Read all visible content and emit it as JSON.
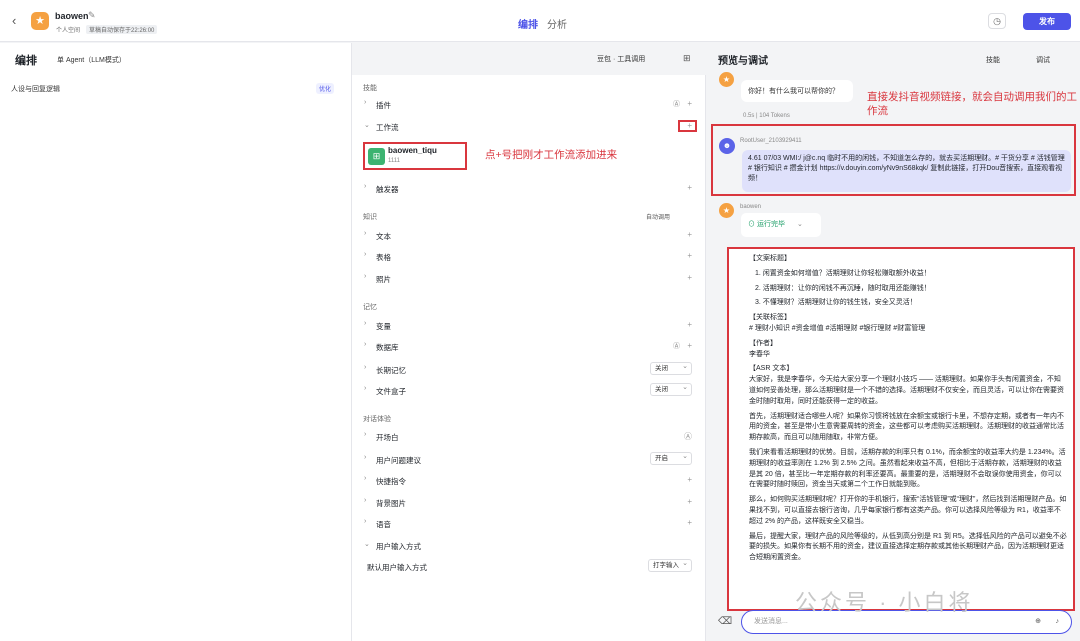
{
  "header": {
    "back": "‹",
    "app_name": "baowen",
    "space": "个人空间",
    "autosave": "草稿自动保存于22:26:00",
    "tab_arrange": "编排",
    "tab_analysis": "分析",
    "publish": "发布"
  },
  "left": {
    "title": "编排",
    "agent_mode": "单 Agent（LLM模式）",
    "persona": "人设与回复逻辑",
    "optimize": "优化"
  },
  "mid": {
    "model": "豆包 · 工具调用",
    "skills_title": "技能",
    "plugin": "插件",
    "workflow": "工作流",
    "wf_name": "baowen_tiqu",
    "wf_sub": "1111",
    "trigger": "触发器",
    "knowledge_title": "知识",
    "auto_call": "自动调用",
    "text": "文本",
    "table": "表格",
    "photo": "照片",
    "memory_title": "记忆",
    "variable": "变量",
    "database": "数据库",
    "long_memory": "长期记忆",
    "long_memory_val": "关闭",
    "filebox": "文件盒子",
    "filebox_val": "关闭",
    "dialog_title": "对话体验",
    "opening": "开场白",
    "suggest": "用户问题建议",
    "suggest_val": "开启",
    "shortcut": "快捷指令",
    "bg_image": "背景图片",
    "voice": "语音",
    "user_input": "用户输入方式",
    "default_input": "默认用户输入方式",
    "default_input_val": "打字输入"
  },
  "annotations": {
    "add": "点+号把刚才工作流添加进来",
    "auto": "直接发抖音视频链接，就会自动调用我们的工作流"
  },
  "preview": {
    "title": "预览与调试",
    "skills": "技能",
    "debug": "调试",
    "greeting": "你好！有什么我可以帮你的？",
    "tokens": "0.5s | 104 Tokens",
    "user_name": "RootUser_2103929411",
    "user_msg": "4.61 07/03 WMI:/ j@c.nq 临时不用的闲钱，不知道怎么存的，就去买活期理财。# 干货分享 # 活钱管理 # 银行知识 # 攒金计划 https://v.douyin.com/yNv9nS68kqk/ 复制此链接，打开Dou音搜索，直接观看视频！",
    "bot_name": "baowen",
    "run_done": "运行完毕",
    "input_placeholder": "发送消息..."
  },
  "output": {
    "l1": "【文案标题】",
    "l2": "1. 闲置资金如何增值？活期理财让你轻松赚取额外收益！",
    "l3": "2. 活期理财：让你的闲钱不再沉睡，随时取用还能赚钱！",
    "l4": "3. 不懂理财？活期理财让你的钱生钱，安全又灵活！",
    "l5": "【关联标签】",
    "l6": "# 理财小知识 #资金增值 #活期理财 #银行理财 #财富管理",
    "l7": "【作者】",
    "l8": "李春华",
    "l9": "【ASR 文本】",
    "p1": "大家好，我是李春华，今天给大家分享一个理财小技巧 —— 活期理财。如果你手头有闲置资金，不知道如何妥善处理，那么活期理财是一个不错的选择。活期理财不仅安全，而且灵活，可以让你在需要资金时随时取用，同时还能获得一定的收益。",
    "p2": "首先，活期理财适合哪些人呢？如果你习惯将钱放在余额宝或银行卡里，不想存定期，或者有一年内不用的资金，甚至是带小生意需要周转的资金，这些都可以考虑购买活期理财。活期理财的收益通常比活期存款高，而且可以随用随取，非常方便。",
    "p3": "我们来看看活期理财的优势。目前，活期存款的利率只有 0.1%，而余额宝的收益率大约是 1.234%。活期理财的收益率则在 1.2% 到 2.5% 之间。虽然看起来收益不高，但相比于活期存款，活期理财的收益是其 20 倍，甚至比一年定期存款的利率还要高。最重要的是，活期理财不会取误你使用资金，你可以在需要时随时赎回，资金当天或第二个工作日就能到账。",
    "p4": "那么，如何购买活期理财呢？打开你的手机银行，搜索“活钱管理”或“理财”，然后找到活期理财产品。如果找不到，可以直接去银行咨询，几乎每家银行都有这类产品。你可以选择风险等级为 R1，收益率不超过 2% 的产品，这样既安全又稳当。",
    "p5": "最后，提醒大家，理财产品的风险等级的，从低到高分别是 R1 到 R5。选择低风险的产品可以避免不必要的损失。如果你有长期不用的资金，建议直接选择定期存款或其他长期理财产品，因为活期理财更适合短期闲置资金。"
  },
  "watermark": "公众号 · 小白将"
}
